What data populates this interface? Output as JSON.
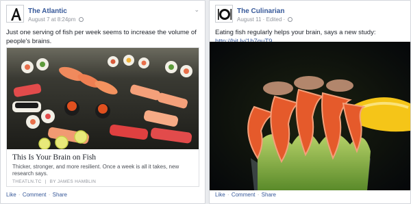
{
  "posts": [
    {
      "page_name": "The Atlantic",
      "timestamp": "August 7 at 8:24pm",
      "privacy_icon": "globe-icon",
      "text": "Just one serving of fish per week seems to increase the volume of people's brains.",
      "link": {
        "title": "This Is Your Brain on Fish",
        "description": "Thicker, stronger, and more resilient. Once a week is all it takes, new research says.",
        "domain": "THEATLN.TC",
        "separator": "|",
        "byline": "BY JAMES HAMBLIN"
      },
      "actions": {
        "like": "Like",
        "comment": "Comment",
        "share": "Share",
        "dot": "·"
      }
    },
    {
      "page_name": "The Culinarian",
      "timestamp": "August 11",
      "edited": "Edited",
      "dot": "·",
      "privacy_icon": "globe-icon",
      "text": "Eating fish regularly helps your brain, says a new study: ",
      "url": "http://bit.ly/1b7quT9",
      "actions": {
        "like": "Like",
        "comment": "Comment",
        "share": "Share",
        "dot": "·"
      }
    }
  ],
  "colors": {
    "link_blue": "#365899",
    "meta_gray": "#90949c",
    "background": "#e9ebee"
  }
}
